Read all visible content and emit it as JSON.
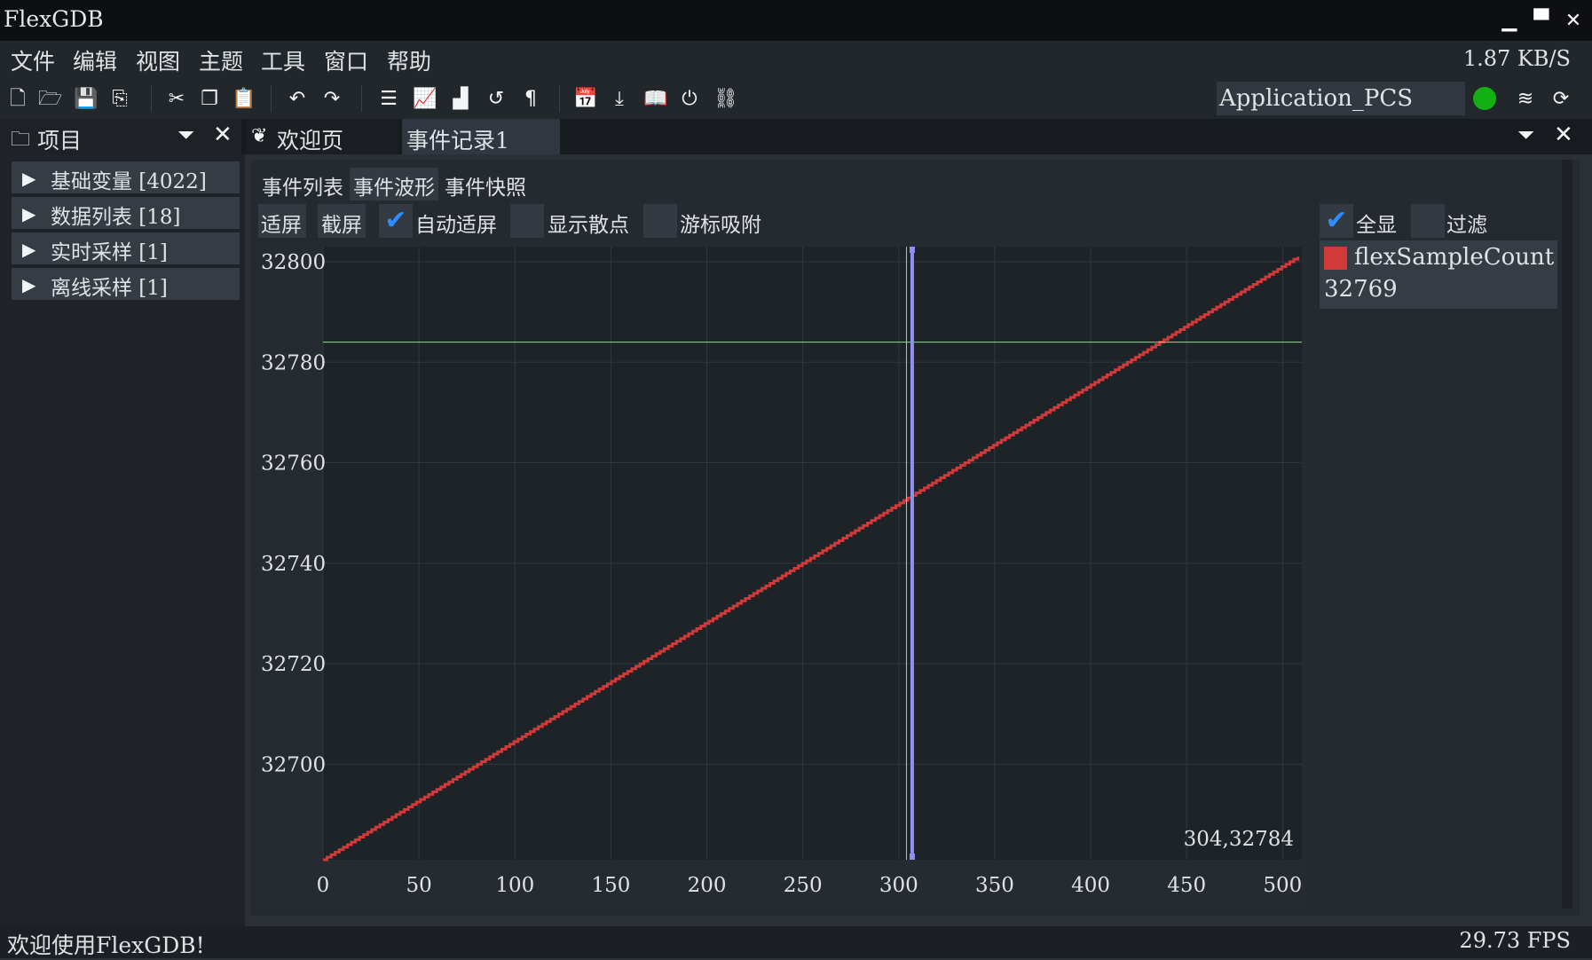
{
  "app": {
    "title": "FlexGDB",
    "window_controls": {
      "minimize": "▁",
      "maximize": "▀",
      "close": "✕"
    }
  },
  "menu": {
    "items": [
      "文件",
      "编辑",
      "视图",
      "主题",
      "工具",
      "窗口",
      "帮助"
    ],
    "net_rate": "1.87 KB/S"
  },
  "toolbar": {
    "icons": [
      "new-file-icon",
      "open-folder-icon",
      "save-icon",
      "save-as-icon",
      "cut-icon",
      "copy-icon",
      "paste-icon",
      "undo-icon",
      "redo-icon",
      "list-icon",
      "line-chart-icon",
      "area-chart-icon",
      "history-icon",
      "paragraph-icon",
      "calendar-check-icon",
      "download-icon",
      "book-icon",
      "power-icon",
      "unlink-icon",
      "layers-icon",
      "refresh-icon"
    ],
    "target": "Application_PCS",
    "status_color": "#12b012"
  },
  "dock": {
    "project_label": "项目",
    "tabs": [
      {
        "label": "欢迎页",
        "active": false
      },
      {
        "label": "事件记录1",
        "active": true
      }
    ]
  },
  "tree": {
    "items": [
      {
        "label": "基础变量 [4022]"
      },
      {
        "label": "数据列表 [18]"
      },
      {
        "label": "实时采样 [1]"
      },
      {
        "label": "离线采样 [1]"
      }
    ]
  },
  "event_view": {
    "subtabs": [
      "事件列表",
      "事件波形",
      "事件快照"
    ],
    "controls": {
      "fit": "适屏",
      "screenshot": "截屏",
      "auto_fit": {
        "label": "自动适屏",
        "checked": true
      },
      "show_scatter": {
        "label": "显示散点",
        "checked": false
      },
      "cursor_snap": {
        "label": "游标吸附",
        "checked": false
      }
    },
    "legend": {
      "show_all": {
        "label": "全显",
        "checked": true
      },
      "filter": {
        "label": "过滤",
        "checked": false
      },
      "series_name": "flexSampleCount",
      "series_value": "32769",
      "series_color": "#d23a3a"
    }
  },
  "chart_data": {
    "type": "line",
    "title": "",
    "xlabel": "",
    "ylabel": "",
    "xlim": [
      0,
      510
    ],
    "ylim": [
      32681,
      32803
    ],
    "x_ticks": [
      0,
      50,
      100,
      150,
      200,
      250,
      300,
      350,
      400,
      450,
      500
    ],
    "y_ticks": [
      32700,
      32720,
      32740,
      32760,
      32780,
      32800
    ],
    "grid": true,
    "series": [
      {
        "name": "flexSampleCount",
        "color": "#d23a3a",
        "x": [
          0,
          508
        ],
        "y": [
          32681,
          32801
        ],
        "step": true
      }
    ],
    "cursor": {
      "x": 307,
      "color": "#8f8ff0"
    },
    "crosshair": {
      "x": 304,
      "y": 32784,
      "color": "#8ee08e"
    },
    "crosshair_readout": "304,32784",
    "colors": {
      "background": "#1e2328",
      "grid": "#2f3840",
      "axis_text": "#dfe3e6"
    }
  },
  "status": {
    "message": "欢迎使用FlexGDB!",
    "fps": "29.73 FPS"
  }
}
